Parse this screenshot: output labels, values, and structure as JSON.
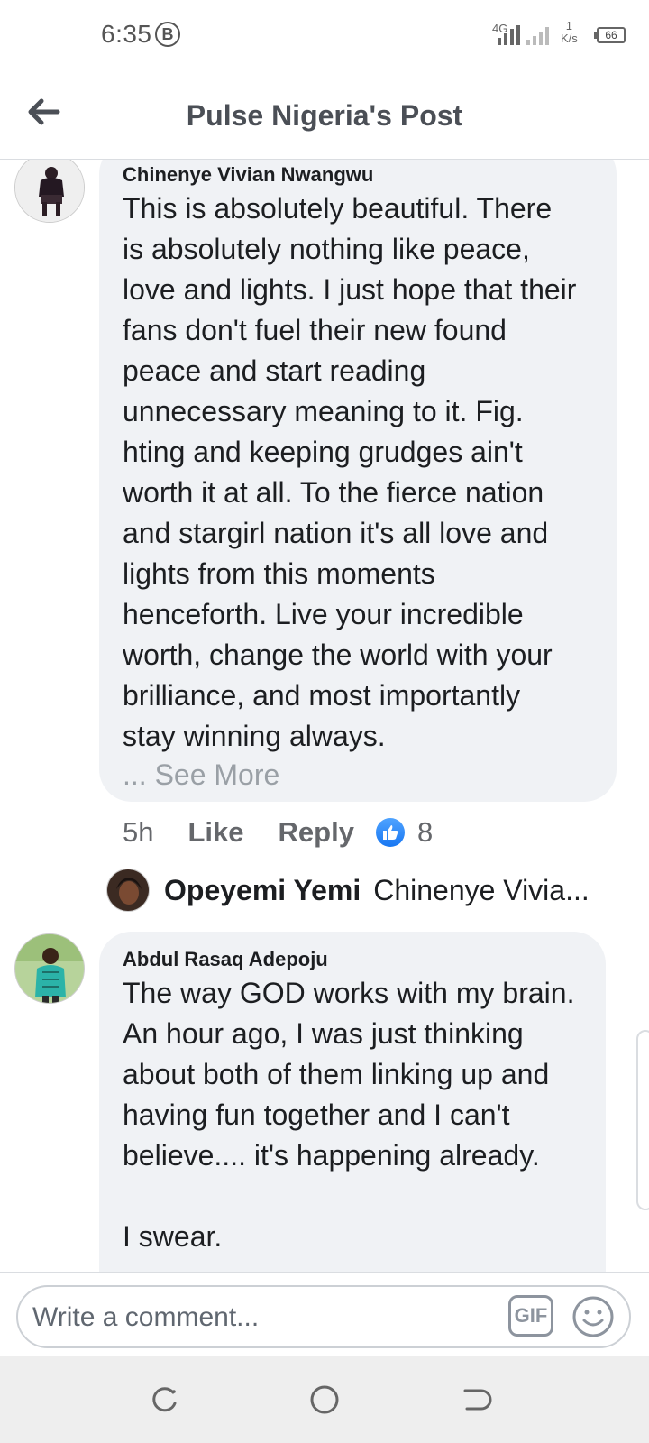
{
  "status_bar": {
    "time": "6:35",
    "carrier_badge": "B",
    "network_label": "4G",
    "speed_value": "1",
    "speed_unit": "K/s",
    "battery": "66"
  },
  "header": {
    "title": "Pulse Nigeria's Post"
  },
  "comments": [
    {
      "author": "Chinenye Vivian Nwangwu",
      "text_lines": [
        "This is absolutely beautiful. There",
        "is absolutely nothing like peace,",
        "love and lights. I just hope that their",
        "fans don't fuel their new found",
        "peace and start reading",
        "unnecessary meaning to it. Fig.",
        "hting and keeping grudges ain't",
        "worth it at all. To the fierce nation",
        "and stargirl nation it's all love and",
        "lights from this moments",
        "henceforth. Live your incredible",
        "worth, change the world with your",
        "brilliance, and most importantly",
        "stay winning always."
      ],
      "see_more": "... See More",
      "time": "5h",
      "like_label": "Like",
      "reply_label": "Reply",
      "like_count": "8",
      "reply_preview": {
        "author": "Opeyemi Yemi",
        "snippet": "Chinenye Vivia..."
      }
    },
    {
      "author": "Abdul Rasaq Adepoju",
      "text_lines": [
        "The way GOD works with my brain.",
        "An hour ago, I was just thinking",
        "about both of them linking up and",
        "having fun together and I can't",
        "believe.... it's happening already.",
        "",
        "I swear."
      ]
    }
  ],
  "composer": {
    "placeholder": "Write a comment...",
    "gif_label": "GIF"
  },
  "colors": {
    "bubble": "#f0f2f5",
    "like_blue": "#1877f2",
    "muted_text": "#65676b"
  }
}
